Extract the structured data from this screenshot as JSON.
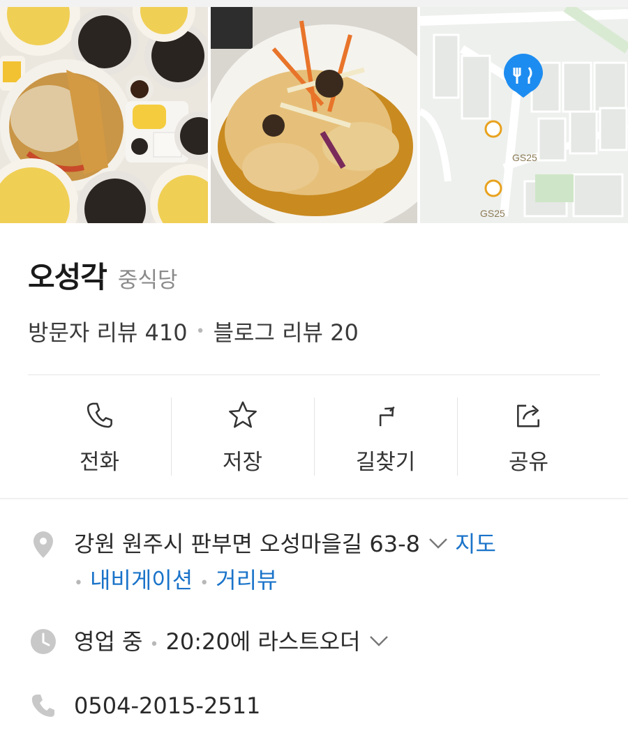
{
  "place": {
    "name": "오성각",
    "category": "중식당"
  },
  "reviews": {
    "visitor": "방문자 리뷰 410",
    "blog": "블로그 리뷰 20"
  },
  "photo_map": {
    "poi1": "GS25",
    "poi2": "GS25"
  },
  "actions": [
    {
      "label": "전화",
      "icon": "phone-icon"
    },
    {
      "label": "저장",
      "icon": "star-icon"
    },
    {
      "label": "길찾기",
      "icon": "directions-icon"
    },
    {
      "label": "공유",
      "icon": "share-icon"
    }
  ],
  "address": {
    "text": "강원 원주시 판부면 오성마을길 63-8",
    "map_link": "지도",
    "navigation_link": "내비게이션",
    "street_view_link": "거리뷰"
  },
  "hours": {
    "status": "영업 중",
    "last_order": "20:20에 라스트오더"
  },
  "phone": {
    "number": "0504-2015-2511"
  },
  "colors": {
    "link": "#1a73c9",
    "map_pin": "#1d8cf0",
    "poi": "#e8a21e"
  }
}
